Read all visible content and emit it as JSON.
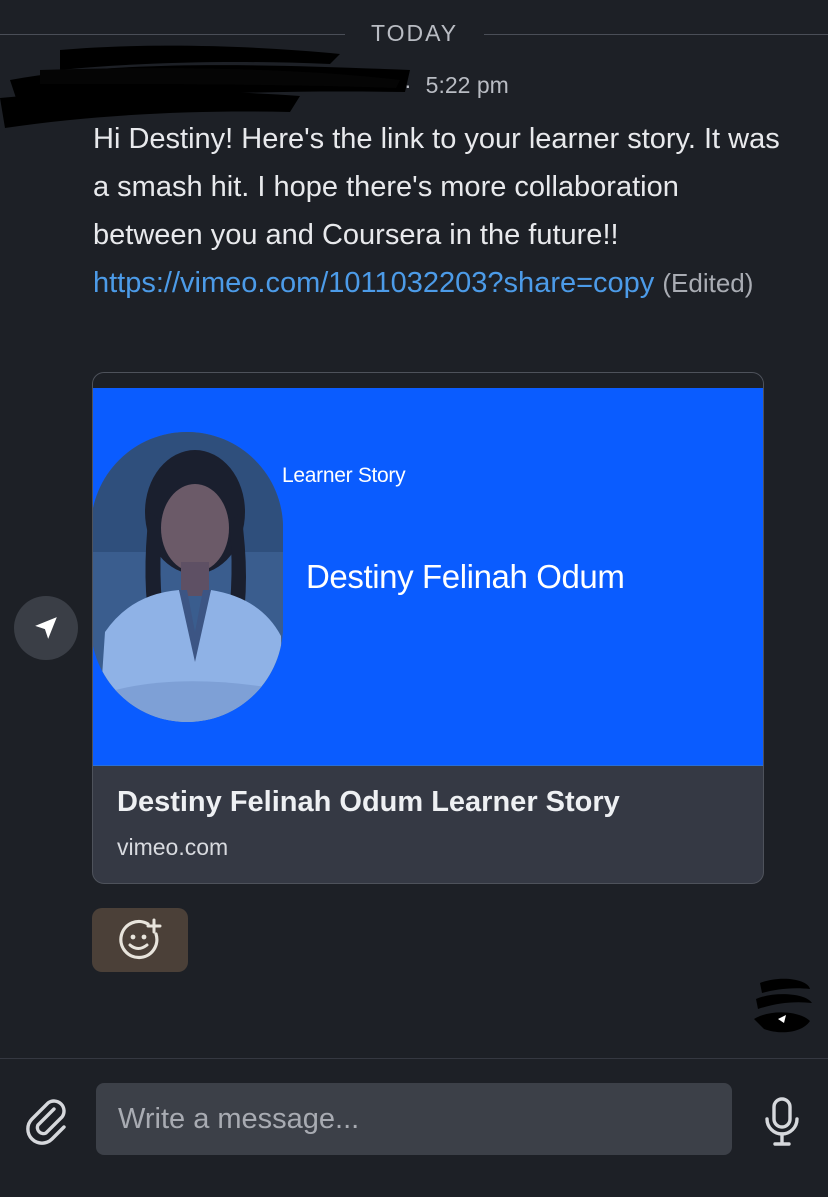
{
  "divider": {
    "label": "TODAY"
  },
  "message": {
    "time": "5:22 pm",
    "time_separator": "·",
    "text": "Hi Destiny!  Here's the link to your learner story.  It was a smash hit.  I hope there's more collaboration between you and Coursera in the future!!",
    "link": "https://vimeo.com/1011032203?share=copy",
    "edited_label": "(Edited)"
  },
  "preview": {
    "thumbnail_kicker": "Learner Story",
    "thumbnail_name": "Destiny Felinah Odum",
    "title": "Destiny Felinah Odum Learner Story",
    "domain": "vimeo.com",
    "accent_color": "#0a5cff"
  },
  "actions": {
    "share_icon": "send-arrow-icon",
    "reaction_icon": "add-reaction-icon"
  },
  "composer": {
    "placeholder": "Write a message...",
    "attach_icon": "paperclip-icon",
    "mic_icon": "microphone-icon"
  },
  "colors": {
    "background": "#1d2026",
    "link": "#4c9be8",
    "reaction_bg": "#4b4038"
  }
}
